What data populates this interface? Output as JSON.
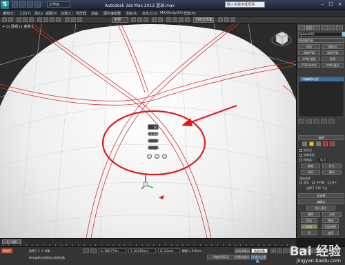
{
  "window": {
    "logo_letter": "S",
    "workspace": "工作台",
    "title": "Autodesk 3ds Max 2012   篮球.max",
    "search_placeholder": "键入关键字或短语"
  },
  "menubar": [
    "编辑(E)",
    "工具(T)",
    "组(G)",
    "视图(V)",
    "创建(C)",
    "修改器",
    "动画",
    "图形编辑器",
    "渲染(R)",
    "自定义(U)",
    "MAXScript(X)",
    "帮助(H)"
  ],
  "toolbar": {
    "selection_filter": "全部",
    "named_selection": "创建选择集"
  },
  "viewport": {
    "label": "+ ] [ 透视 ] [ 真实 ]",
    "caddy": {
      "title": "切角",
      "amount": "0.3mm"
    }
  },
  "command_panel": {
    "object_name": "Sphere001",
    "modifier_list": "修改器列表",
    "buttons": [
      "挤出",
      "面挤出",
      "网格平滑",
      "涡轮平滑",
      "UVW 贴图",
      "补洞",
      "FFD 4x4x4",
      "UVW 展开"
    ],
    "stack_item": "可编辑多边形",
    "rollouts": {
      "selection": "选择",
      "soft_selection": "软选择",
      "edit_edges": "编辑边",
      "insert_vertex": "插入顶点",
      "remove": "移除",
      "split": "分割",
      "extrude": "挤出",
      "weld": "焊接",
      "chamfer": "切角",
      "target_weld": "目标焊接",
      "bridge": "桥",
      "connect": "连接",
      "create_shape": "利用所选内容创建图形",
      "edit_tri": "编辑三角形",
      "turn": "旋转"
    },
    "options": {
      "by_vertex": "按顶点",
      "ignore_backfacing": "忽略背面",
      "by_angle": "按角度:",
      "by_angle_value": "45.0",
      "shrink": "收缩",
      "grow": "扩大",
      "ring": "环形",
      "loop": "循环",
      "preview_selection": "预览选择",
      "off": "禁用",
      "subobject": "子对象",
      "multi": "多个",
      "selected_count": "选择了 136 个边"
    }
  },
  "timeline": {
    "slider": "0 / 100",
    "ticks": [
      "0",
      "10",
      "20",
      "30",
      "40",
      "50",
      "60",
      "70",
      "80",
      "90",
      "100"
    ]
  },
  "status": {
    "mode_button": "所在行",
    "selected": "选择了 1 个 对象",
    "prompt": "单击或单击并拖动以选择对象",
    "x": "X: 180.773m",
    "y": "Y: 38.600mm",
    "z": "Z: 0.0mm",
    "grid": "栅格 = 0.0mm",
    "auto_key": "自动关键点",
    "set_key": "设置关键点",
    "key_filter": "关键点过滤器...",
    "add_time_tag": "添加时间标记",
    "selected_label": "选定对象"
  },
  "watermark": {
    "brand": "Bai 经验",
    "url": "jingyan.baidu.com"
  },
  "colors": {
    "annotation_red": "#e01818",
    "edge_red": "#cc3333",
    "stack_highlight": "#3b6ea8"
  }
}
